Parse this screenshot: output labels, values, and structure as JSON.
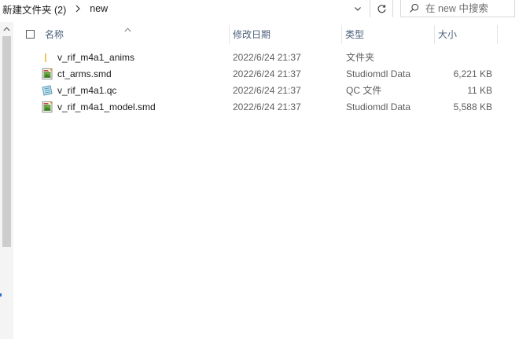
{
  "address": {
    "breadcrumbs": [
      "新建文件夹 (2)",
      "new"
    ]
  },
  "search": {
    "placeholder": "在 new 中搜索"
  },
  "columns": {
    "name": "名称",
    "date": "修改日期",
    "type": "类型",
    "size": "大小"
  },
  "files": [
    {
      "name": "v_rif_m4a1_anims",
      "date": "2022/6/24 21:37",
      "type": "文件夹",
      "size": "",
      "icon": "folder-icon"
    },
    {
      "name": "ct_arms.smd",
      "date": "2022/6/24 21:37",
      "type": "Studiomdl Data",
      "size": "6,221 KB",
      "icon": "smd-file-icon"
    },
    {
      "name": "v_rif_m4a1.qc",
      "date": "2022/6/24 21:37",
      "type": "QC 文件",
      "size": "11 KB",
      "icon": "qc-file-icon"
    },
    {
      "name": "v_rif_m4a1_model.smd",
      "date": "2022/6/24 21:37",
      "type": "Studiomdl Data",
      "size": "5,588 KB",
      "icon": "smd-file-icon"
    }
  ],
  "colors": {
    "header_text": "#4c607a",
    "secondary_text": "#5d5d5d",
    "folder": "#f2c94c"
  }
}
